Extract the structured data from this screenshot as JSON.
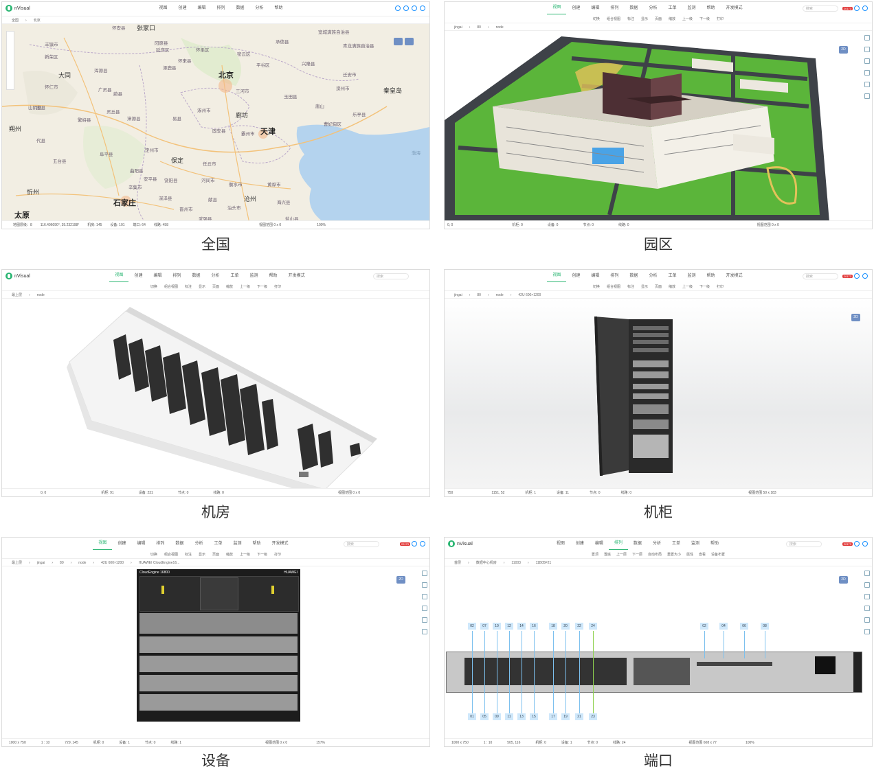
{
  "captions": [
    "全国",
    "园区",
    "机房",
    "机柜",
    "设备",
    "端口"
  ],
  "app_name": "nVisual",
  "menu_short": [
    "视图",
    "创建",
    "编辑",
    "排列",
    "数据",
    "分析",
    "帮助"
  ],
  "menu_long": [
    "视图",
    "创建",
    "编辑",
    "排列",
    "数据",
    "分析",
    "工单",
    "监测",
    "帮助",
    "开发模式"
  ],
  "toolbar": [
    "切换",
    "组合视图",
    "标注",
    "显示",
    "页面",
    "缩放",
    "上一级",
    "下一级",
    "打印"
  ],
  "search_placeholder": "搜索",
  "badge": "20173",
  "btn_2d": "2D",
  "map": {
    "crumb": [
      "全国",
      "北京"
    ],
    "cities_major": [
      "北京",
      "天津",
      "石家庄",
      "太原",
      "大同",
      "张家口",
      "秦皇岛",
      "保定",
      "廊坊",
      "朔州",
      "沧州",
      "忻州"
    ],
    "cities_minor": [
      "怀安县",
      "丰镇市",
      "新荣区",
      "怀仁市",
      "应县",
      "山阴县",
      "代县",
      "五台县",
      "涞源县",
      "易县",
      "涿州市",
      "固安县",
      "霸州市",
      "任丘市",
      "河间市",
      "献县",
      "深泽县",
      "晋州市",
      "辛集市",
      "衡水市",
      "唐山",
      "玉田县",
      "三河市",
      "平谷区",
      "密云区",
      "怀柔区",
      "延庆区",
      "兴隆县",
      "承德县",
      "宽城满族自治县",
      "青龙满族自治县",
      "迁安市",
      "滦州市",
      "乐亭县",
      "曹妃甸区",
      "黄骅市",
      "海兴县",
      "盐山县",
      "泊头市",
      "武强县",
      "饶阳县",
      "安平县",
      "定州市",
      "曲阳县",
      "阜平县",
      "灵丘县",
      "繁峙县",
      "浑源县",
      "广灵县",
      "蔚县",
      "阳原县",
      "涿鹿县",
      "怀来县",
      "渤海"
    ],
    "status": [
      "地图层级：8",
      "116.496090°, 39.232198°",
      "机房: 145",
      "设备: 101",
      "端口: 64",
      "线路: 458",
      "视图范围 0 x 0",
      "100%"
    ]
  },
  "park": {
    "crumb": [
      "jingai",
      "80",
      "node"
    ],
    "status": [
      "0, 0",
      "机柜: 0",
      "设备: 0",
      "节点: 0",
      "线路: 0",
      "视图范围 0 x 0"
    ]
  },
  "room": {
    "crumb": [
      "最上层",
      "node"
    ],
    "status": [
      "0, 0",
      "机柜: 91",
      "设备: 231",
      "节点: 0",
      "线路: 0",
      "视图范围 0 x 0"
    ]
  },
  "rack": {
    "crumb": [
      "jingai",
      "80",
      "node",
      "42U 600×1200"
    ],
    "status": [
      "750",
      "1151, 52",
      "机柜: 1",
      "设备: 11",
      "节点: 0",
      "线路: 0",
      "视图范围 50 x 183"
    ]
  },
  "device": {
    "crumb": [
      "最上层",
      "jingai",
      "80",
      "node",
      "42U 600×1200",
      "HUAWEI CloudEngine16..."
    ],
    "model": "CloudEngine 16800",
    "brand": "HUAWEI",
    "status": [
      "1000 x 750",
      "1 : 10",
      "729, 145",
      "机柜: 0",
      "设备: 1",
      "节点: 0",
      "线路: 1",
      "视图范围 0 x 0",
      "157%"
    ]
  },
  "port": {
    "crumb": [
      "首层",
      "数据中心机房",
      "11003",
      "11B05F21"
    ],
    "toolbar": [
      "置顶",
      "置底",
      "上一层",
      "下一层",
      "自动布局",
      "重置大小",
      "属性",
      "查看",
      "设备布置"
    ],
    "ports_top": [
      "02",
      "07",
      "10",
      "12",
      "14",
      "16",
      "18",
      "20",
      "22",
      "24",
      "02",
      "04",
      "06",
      "08"
    ],
    "ports_bottom": [
      "01",
      "05",
      "09",
      "11",
      "13",
      "15",
      "17",
      "19",
      "21",
      "23"
    ],
    "status": [
      "1000 x 750",
      "1 : 10",
      "505, 116",
      "机柜: 0",
      "设备: 1",
      "节点: 0",
      "线路: 24",
      "视图范围 608 x 77",
      "100%"
    ]
  }
}
